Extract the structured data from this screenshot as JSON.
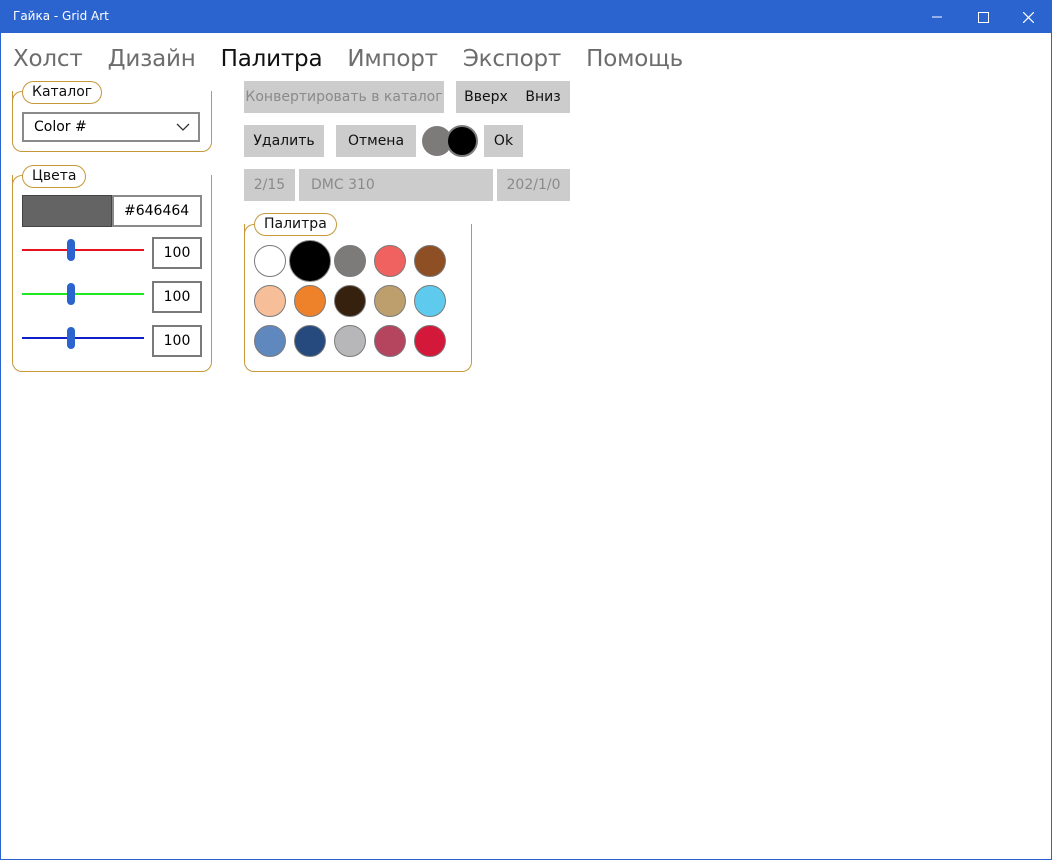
{
  "window": {
    "title": "Гайка - Grid Art"
  },
  "menu": {
    "items": [
      {
        "label": "Холст",
        "active": false
      },
      {
        "label": "Дизайн",
        "active": false
      },
      {
        "label": "Палитра",
        "active": true
      },
      {
        "label": "Импорт",
        "active": false
      },
      {
        "label": "Экспорт",
        "active": false
      },
      {
        "label": "Помощь",
        "active": false
      }
    ]
  },
  "catalog": {
    "label": "Каталог",
    "selected": "Color #"
  },
  "colors": {
    "label": "Цвета",
    "swatch_color": "#646464",
    "hex_value": "#646464",
    "red": {
      "value": "100",
      "track_color": "#e81123"
    },
    "green": {
      "value": "100",
      "track_color": "#22e822"
    },
    "blue": {
      "value": "100",
      "track_color": "#1020c8"
    },
    "slider_thumb_color": "#2b63cf"
  },
  "toolbar": {
    "convert_label": "Конвертировать в каталог",
    "up_label": "Вверх",
    "down_label": "Вниз",
    "delete_label": "Удалить",
    "cancel_label": "Отмена",
    "ok_label": "Ok",
    "index_label": "2/15",
    "name_label": "DMC 310",
    "position_label": "202/1/0"
  },
  "palette": {
    "label": "Палитра",
    "swatches": [
      "#ffffff",
      "#000000",
      "#7d7a7a",
      "#ef6260",
      "#8e4f24",
      "#f7bf99",
      "#ee822a",
      "#36200e",
      "#bd9f6e",
      "#5ecbee",
      "#5f89be",
      "#264a7e",
      "#b7b7b9",
      "#b5445f",
      "#d4183a"
    ],
    "selected_index": 1
  },
  "accent_color": "#2b63cf",
  "group_border_color": "#c7973a"
}
